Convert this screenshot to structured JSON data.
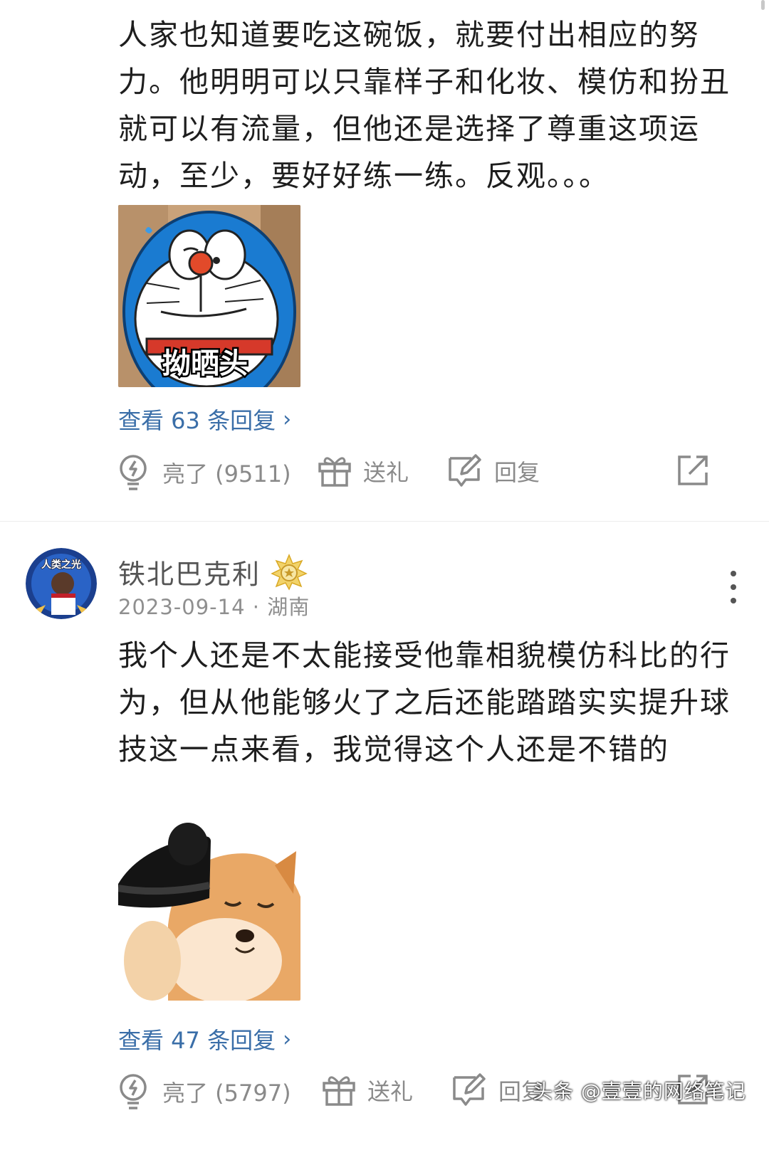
{
  "comment1": {
    "text": "人家也知道要吃这碗饭，就要付出相应的努力。他明明可以只靠样子和化妆、模仿和扮丑就可以有流量，但他还是选择了尊重这项运动，至少，要好好练一练。反观。。。",
    "sticker_caption": "拗晒头",
    "view_replies": "查看 63 条回复",
    "like_label": "亮了 (9511)",
    "gift_label": "送礼",
    "reply_label": "回复"
  },
  "comment2": {
    "avatar_badge_text": "人类之光",
    "username": "铁北巴克利",
    "meta": "2023-09-14 · 湖南",
    "text": "我个人还是不太能接受他靠相貌模仿科比的行为，但从他能够火了之后还能踏踏实实提升球技这一点来看，我觉得这个人还是不错的",
    "view_replies": "查看 47 条回复",
    "like_label": "亮了 (5797)",
    "gift_label": "送礼",
    "reply_label": "回复"
  },
  "watermark": "头条 @壹壹的网络笔记",
  "icons": {
    "like": "lightbulb-icon",
    "gift": "gift-icon",
    "reply": "edit-reply-icon",
    "share": "share-icon",
    "more": "more-vertical-icon",
    "chevron": "chevron-right-icon",
    "badge": "level-badge-icon"
  },
  "colors": {
    "link": "#3a6ea8",
    "muted": "#8a8a8a",
    "text": "#1e1e1e"
  }
}
